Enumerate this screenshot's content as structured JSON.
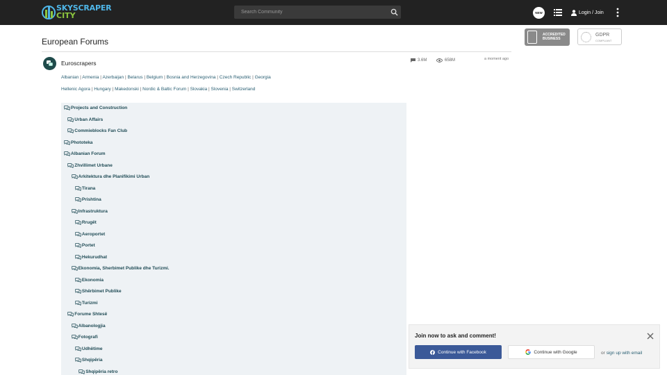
{
  "header": {
    "logo_line1": "SKYSCRAPER",
    "logo_line2": "CITY",
    "search_placeholder": "Search Community",
    "new_badge": "NEW",
    "login_label": "Login / Join"
  },
  "page": {
    "title": "European Forums"
  },
  "badges": {
    "bbb_line1": "ACCREDITED",
    "bbb_line2": "BUSINESS",
    "bbb_seal": "BBB",
    "gdpr_line1": "GDPR",
    "gdpr_line2": "COMPLIANT"
  },
  "forum": {
    "name": "Euroscrapers",
    "threads": "3.6M",
    "views": "658M",
    "last_activity": "a moment ago",
    "subforums_row1": [
      "Albanian",
      "Armenia",
      "Azerbaijan",
      "Belarus",
      "Belgium",
      "Bosnia and Herzegovina",
      "Czech Republic",
      "Georgia"
    ],
    "subforums_row2": [
      "Hellenic Agora",
      "Hungary",
      "Makedonski",
      "Nordic & Baltic Forum",
      "Slovakia",
      "Slovenia",
      "Switzerland"
    ]
  },
  "tree": [
    {
      "label": "Projects and Construction",
      "depth": 0
    },
    {
      "label": "Urban Affairs",
      "depth": 1
    },
    {
      "label": "Commieblocks Fan Club",
      "depth": 1
    },
    {
      "label": "Phototeka",
      "depth": 0
    },
    {
      "label": "Albanian Forum",
      "depth": 0
    },
    {
      "label": "Zhvillimet Urbane",
      "depth": 1
    },
    {
      "label": "Arkitektura dhe Planifikimi Urban",
      "depth": 2
    },
    {
      "label": "Tirana",
      "depth": 3
    },
    {
      "label": "Prishtina",
      "depth": 3
    },
    {
      "label": "Infrastruktura",
      "depth": 2
    },
    {
      "label": "Rrugët",
      "depth": 3
    },
    {
      "label": "Aeroportet",
      "depth": 3
    },
    {
      "label": "Portet",
      "depth": 3
    },
    {
      "label": "Hekurudhat",
      "depth": 3
    },
    {
      "label": "Ekonomia, Sherbimet Publike dhe Turizmi.",
      "depth": 2
    },
    {
      "label": "Ekonomia",
      "depth": 3
    },
    {
      "label": "Shërbimet Publike",
      "depth": 3
    },
    {
      "label": "Turizmi",
      "depth": 3
    },
    {
      "label": "Forume Shtesë",
      "depth": 1
    },
    {
      "label": "Albanologjia",
      "depth": 2
    },
    {
      "label": "Fotografi",
      "depth": 2
    },
    {
      "label": "Udhëtime",
      "depth": 3
    },
    {
      "label": "Shqipëria",
      "depth": 3
    },
    {
      "label": "Shqipëria retro",
      "depth": 4
    }
  ],
  "popup": {
    "title": "Join now to ask and comment!",
    "facebook_label": "Continue with Facebook",
    "google_label": "Continue with Google",
    "or_text": "or",
    "email_link": "sign up with email"
  },
  "colors": {
    "topbar": "#222222",
    "link": "#2a5f73",
    "tree_bg": "#eef2f5",
    "facebook": "#3b5998",
    "logo_blue": "#4fb6e8",
    "logo_green": "#8cc63f"
  }
}
